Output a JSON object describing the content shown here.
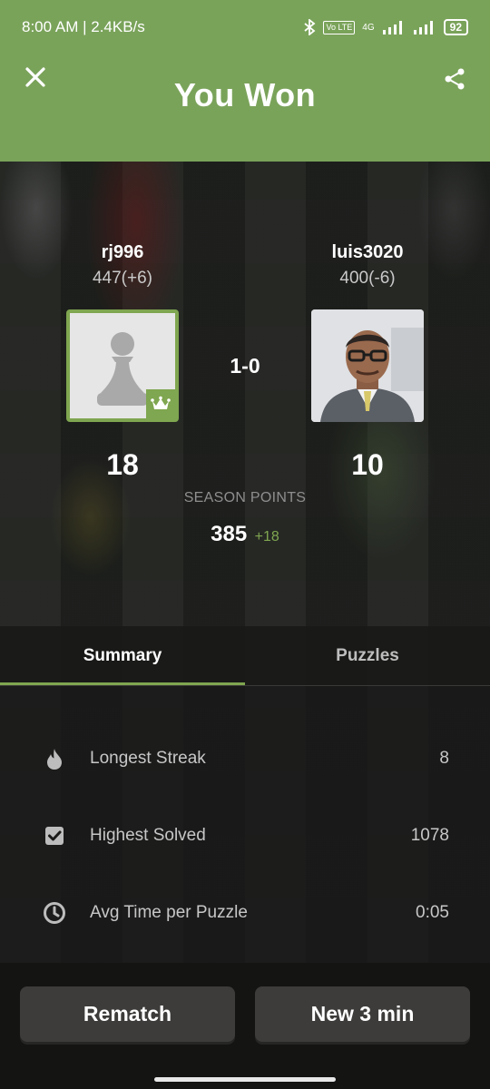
{
  "status_bar": {
    "time": "8:00 AM | 2.4KB/s",
    "network": "4G",
    "battery": "92"
  },
  "header": {
    "title": "You Won"
  },
  "players": [
    {
      "name": "rj996",
      "rating": "447(+6)",
      "points": "18",
      "avatar": "pawn-avatar",
      "winner": true
    },
    {
      "name": "luis3020",
      "rating": "400(-6)",
      "points": "10",
      "avatar": "photo-avatar",
      "winner": false
    }
  ],
  "score": "1-0",
  "season": {
    "label": "SEASON POINTS",
    "total": "385",
    "gain": "+18"
  },
  "tabs": [
    {
      "label": "Summary",
      "active": true
    },
    {
      "label": "Puzzles",
      "active": false
    }
  ],
  "stats": [
    {
      "icon": "flame-icon",
      "label": "Longest Streak",
      "value": "8"
    },
    {
      "icon": "checkbox-icon",
      "label": "Highest Solved",
      "value": "1078"
    },
    {
      "icon": "clock-icon",
      "label": "Avg Time per Puzzle",
      "value": "0:05"
    }
  ],
  "buttons": {
    "rematch": "Rematch",
    "new_game": "New 3 min"
  },
  "colors": {
    "accent": "#7fa650",
    "header": "#7aa35a",
    "button": "#3d3c3a"
  }
}
